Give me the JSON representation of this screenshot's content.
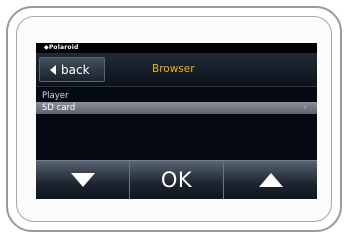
{
  "device": {
    "brand": "◆Polaroid"
  },
  "header": {
    "back_label": "back",
    "title": "Browser"
  },
  "list": {
    "items": [
      {
        "label": "Player",
        "selected": false
      },
      {
        "label": "SD card",
        "selected": true
      }
    ],
    "chevron": "›"
  },
  "controls": {
    "down_icon": "triangle-down-icon",
    "ok_label": "OK",
    "up_icon": "triangle-up-icon"
  },
  "colors": {
    "title_accent": "#e8b50f",
    "screen_bg": "#050a12"
  }
}
